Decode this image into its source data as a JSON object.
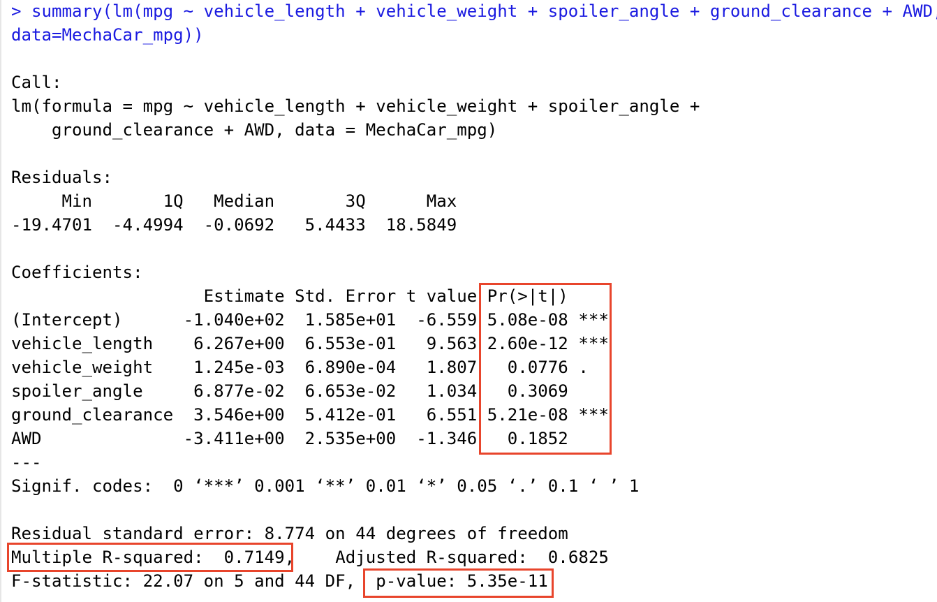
{
  "colors": {
    "command_text": "#1a1ae0",
    "output_text": "#000000",
    "highlight_box": "#e8452c",
    "background": "#ffffff"
  },
  "lines": [
    {
      "kind": "command",
      "text": "> summary(lm(mpg ~ vehicle_length + vehicle_weight + spoiler_angle + ground_clearance + AWD,"
    },
    {
      "kind": "command",
      "text": "data=MechaCar_mpg))"
    },
    {
      "kind": "blank",
      "text": ""
    },
    {
      "kind": "output",
      "text": "Call:"
    },
    {
      "kind": "output",
      "text": "lm(formula = mpg ~ vehicle_length + vehicle_weight + spoiler_angle +"
    },
    {
      "kind": "output",
      "text": "    ground_clearance + AWD, data = MechaCar_mpg)"
    },
    {
      "kind": "blank",
      "text": ""
    },
    {
      "kind": "output",
      "text": "Residuals:"
    },
    {
      "kind": "output",
      "text": "     Min       1Q   Median       3Q      Max "
    },
    {
      "kind": "output",
      "text": "-19.4701  -4.4994  -0.0692   5.4433  18.5849 "
    },
    {
      "kind": "blank",
      "text": ""
    },
    {
      "kind": "output",
      "text": "Coefficients:"
    },
    {
      "kind": "output",
      "text": "                   Estimate Std. Error t value Pr(>|t|)    "
    },
    {
      "kind": "output",
      "text": "(Intercept)      -1.040e+02  1.585e+01  -6.559 5.08e-08 ***"
    },
    {
      "kind": "output",
      "text": "vehicle_length    6.267e+00  6.553e-01   9.563 2.60e-12 ***"
    },
    {
      "kind": "output",
      "text": "vehicle_weight    1.245e-03  6.890e-04   1.807   0.0776 .  "
    },
    {
      "kind": "output",
      "text": "spoiler_angle     6.877e-02  6.653e-02   1.034   0.3069    "
    },
    {
      "kind": "output",
      "text": "ground_clearance  3.546e+00  5.412e-01   6.551 5.21e-08 ***"
    },
    {
      "kind": "output",
      "text": "AWD              -3.411e+00  2.535e+00  -1.346   0.1852    "
    },
    {
      "kind": "output",
      "text": "---"
    },
    {
      "kind": "output",
      "text": "Signif. codes:  0 ‘***’ 0.001 ‘**’ 0.01 ‘*’ 0.05 ‘.’ 0.1 ‘ ’ 1"
    },
    {
      "kind": "blank",
      "text": ""
    },
    {
      "kind": "output",
      "text": "Residual standard error: 8.774 on 44 degrees of freedom"
    },
    {
      "kind": "output",
      "text": "Multiple R-squared:  0.7149,\tAdjusted R-squared:  0.6825 "
    },
    {
      "kind": "output",
      "text": "F-statistic: 22.07 on 5 and 44 DF,  p-value: 5.35e-11"
    }
  ]
}
